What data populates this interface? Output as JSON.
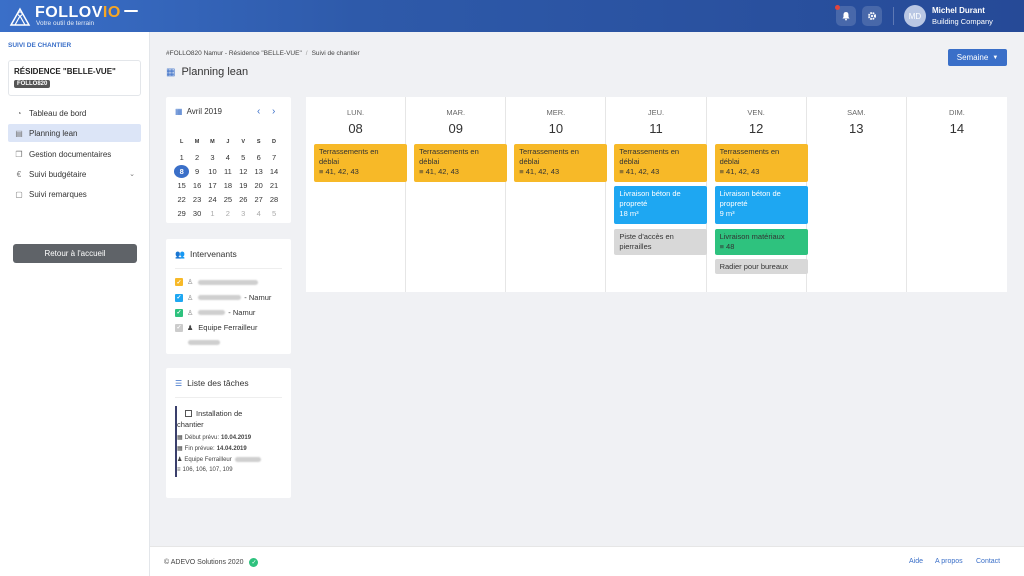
{
  "brand": {
    "name_a": "FOLLOV",
    "name_b": "IO",
    "tagline": "Votre outil de terrain"
  },
  "user": {
    "initials": "MD",
    "name": "Michel Durant",
    "company": "Building Company"
  },
  "sidebar": {
    "section": "SUIVI DE CHANTIER",
    "project": {
      "name": "RÉSIDENCE \"BELLE-VUE\"",
      "code": "FOLLO820"
    },
    "items": [
      {
        "label": "Tableau de bord",
        "icon": "dashboard-icon"
      },
      {
        "label": "Planning lean",
        "icon": "calendar-icon"
      },
      {
        "label": "Gestion documentaires",
        "icon": "documents-icon"
      },
      {
        "label": "Suivi budgétaire",
        "icon": "euro-icon"
      },
      {
        "label": "Suivi remarques",
        "icon": "comments-icon"
      }
    ],
    "back": "Retour à l'accueil"
  },
  "breadcrumb": {
    "project": "#FOLLO820 Namur - Résidence \"BELLE-VUE\"",
    "page": "Suivi de chantier"
  },
  "title": "Planning lean",
  "view_button": "Semaine",
  "mini_calendar": {
    "month": "Avril 2019",
    "weekdays": [
      "L",
      "M",
      "M",
      "J",
      "V",
      "S",
      "D"
    ],
    "weeks": [
      [
        "1",
        "2",
        "3",
        "4",
        "5",
        "6",
        "7"
      ],
      [
        "8",
        "9",
        "10",
        "11",
        "12",
        "13",
        "14"
      ],
      [
        "15",
        "16",
        "17",
        "18",
        "19",
        "20",
        "21"
      ],
      [
        "22",
        "23",
        "24",
        "25",
        "26",
        "27",
        "28"
      ],
      [
        "29",
        "30",
        "1",
        "2",
        "3",
        "4",
        "5"
      ]
    ],
    "selected": "8"
  },
  "intervenants": {
    "title": "Intervenants",
    "rows": [
      {
        "suffix": "",
        "color": "#f7b928"
      },
      {
        "suffix": "- Namur",
        "color": "#1ea7f2"
      },
      {
        "suffix": "- Namur",
        "color": "#2ec27e"
      },
      {
        "suffix": "Equipe Ferrailleur",
        "color": "#cccccc"
      }
    ]
  },
  "tasks_list": {
    "title": "Liste des tâches",
    "task": {
      "name_1": "Installation de",
      "name_2": "chantier",
      "start_label": "Début prévu:",
      "start": "10.04.2019",
      "end_label": "Fin prévue:",
      "end": "14.04.2019",
      "team": "Equipe Ferrailleur",
      "refs": "106, 106, 107, 109"
    }
  },
  "week": {
    "days": [
      {
        "name": "LUN.",
        "num": "08"
      },
      {
        "name": "MAR.",
        "num": "09"
      },
      {
        "name": "MER.",
        "num": "10"
      },
      {
        "name": "JEU.",
        "num": "11"
      },
      {
        "name": "VEN.",
        "num": "12"
      },
      {
        "name": "SAM.",
        "num": "13"
      },
      {
        "name": "DIM.",
        "num": "14"
      }
    ],
    "tasks": {
      "t_earth": {
        "l1": "Terrassements en",
        "l2": "déblai",
        "meta": "41, 42, 43"
      },
      "t_beton11": {
        "l1": "Livraison béton de",
        "l2": "propreté",
        "meta": "18 m³"
      },
      "t_piste": {
        "l1": "Piste d'accès en",
        "l2": "pierrailles"
      },
      "t_beton12": {
        "l1": "Livraison béton de",
        "l2": "propreté",
        "meta": "9 m³"
      },
      "t_mat": {
        "l1": "Livraison matériaux",
        "meta": "48"
      },
      "t_radier": {
        "l1": "Radier pour bureaux"
      }
    }
  },
  "footer": {
    "copyright": "© ADEVO Solutions 2020",
    "links": [
      "Aide",
      "A propos",
      "Contact"
    ]
  }
}
